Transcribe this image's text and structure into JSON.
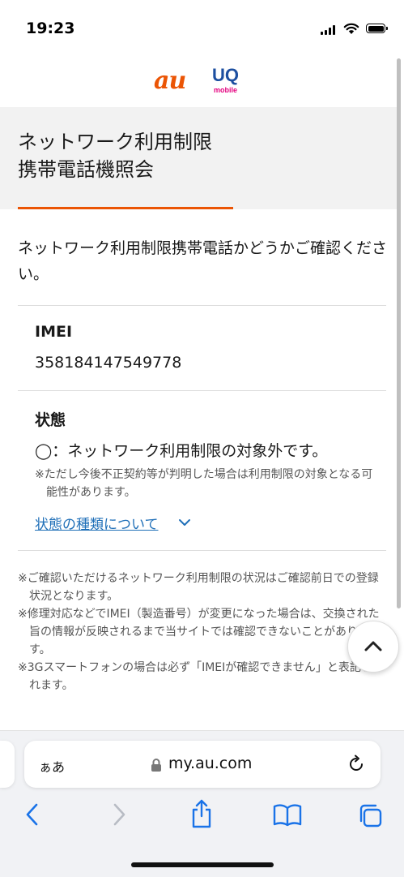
{
  "status_bar": {
    "time": "19:23"
  },
  "header": {
    "logo_primary": "au",
    "logo_secondary": "UQ",
    "logo_secondary_sub": "mobile"
  },
  "page": {
    "title_line1": "ネットワーク利用制限",
    "title_line2": "携帯電話機照会",
    "intro": "ネットワーク利用制限携帯電話かどうかご確認ください。"
  },
  "imei": {
    "label": "IMEI",
    "value": "358184147549778"
  },
  "status": {
    "label": "状態",
    "value": "◯：ネットワーク利用制限の対象外です。",
    "note": "※ただし今後不正契約等が判明した場合は利用制限の対象となる可能性があります。",
    "link": "状態の種類について"
  },
  "footnotes": [
    "※ご確認いただけるネットワーク利用制限の状況はご確認前日での登録状況となります。",
    "※修理対応などでIMEI（製造番号）が変更になった場合は、交換された旨の情報が反映されるまで当サイトでは確認できないことがあります。",
    "※3Gスマートフォンの場合は必ず「IMEIが確認できません」と表記されます。"
  ],
  "browser": {
    "text_size_label": "ぁあ",
    "url": "my.au.com"
  },
  "colors": {
    "brand_orange": "#eb5505",
    "link_blue": "#1f6fb8",
    "uq_blue": "#1d4fa0",
    "uq_pink": "#e4007f",
    "ios_blue": "#1a73e8"
  },
  "icons": [
    "signal-icon",
    "wifi-icon",
    "battery-icon",
    "chevron-down-icon",
    "chevron-up-icon",
    "lock-icon",
    "reload-icon",
    "back-icon",
    "forward-icon",
    "share-icon",
    "bookmarks-icon",
    "tabs-icon"
  ]
}
